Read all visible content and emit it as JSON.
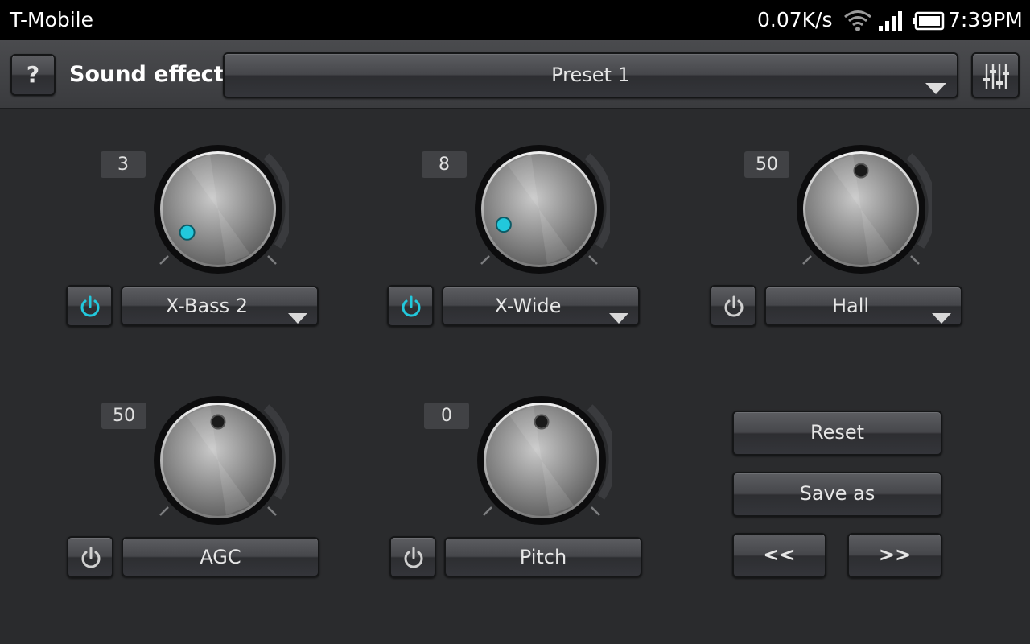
{
  "status_bar": {
    "carrier": "T-Mobile",
    "net_speed": "0.07K/s",
    "time": "7:39PM",
    "icons": [
      "wifi-icon",
      "signal-icon",
      "battery-icon"
    ]
  },
  "header": {
    "help_label": "?",
    "title": "Sound effects",
    "preset_value": "Preset 1",
    "equalizer_icon": "equalizer-sliders-icon"
  },
  "effects": [
    {
      "value": "3",
      "label": "X-Bass 2",
      "enabled": true,
      "has_dropdown": true,
      "level": 0.03
    },
    {
      "value": "8",
      "label": "X-Wide",
      "enabled": true,
      "has_dropdown": true,
      "level": 0.08
    },
    {
      "value": "50",
      "label": "Hall",
      "enabled": false,
      "has_dropdown": true,
      "level": 0.5
    },
    {
      "value": "50",
      "label": "AGC",
      "enabled": false,
      "has_dropdown": false,
      "level": 0.5
    },
    {
      "value": "0",
      "label": "Pitch",
      "enabled": false,
      "has_dropdown": false,
      "level": 0.5
    }
  ],
  "actions": {
    "reset_label": "Reset",
    "save_as_label": "Save as",
    "prev_label": "<<",
    "next_label": ">>"
  },
  "colors": {
    "active_accent": "#22c8dc",
    "inactive_dot": "#1a1a1a",
    "background": "#2a2b2d"
  }
}
